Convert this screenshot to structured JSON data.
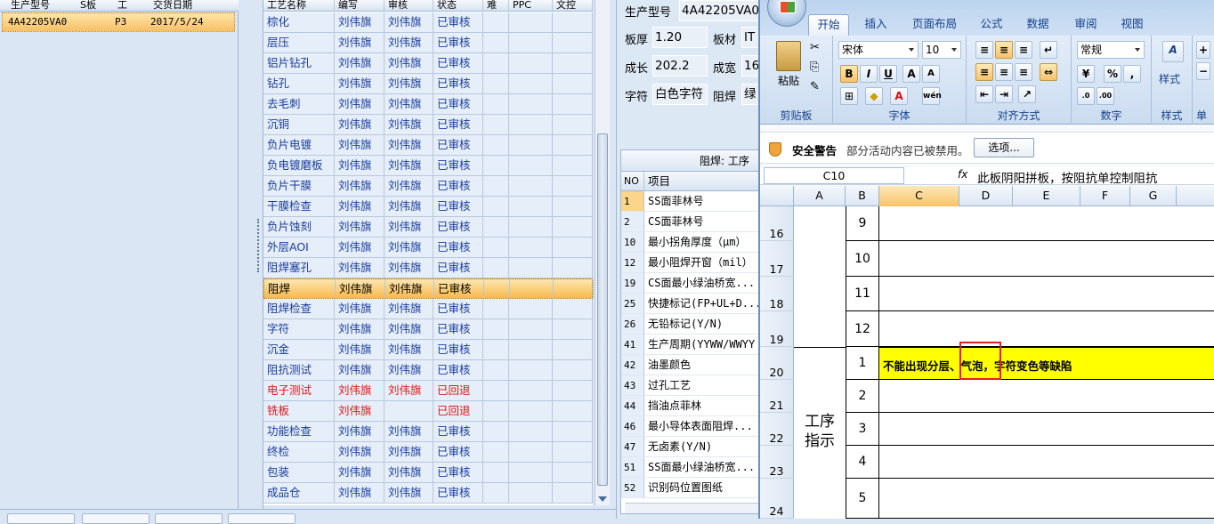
{
  "left_panel": {
    "headers": [
      "生产型号",
      "S板",
      "工",
      "交货日期"
    ],
    "row": {
      "model": "4A42205VA0",
      "grade": "P3",
      "date": "2017/5/24"
    }
  },
  "process_grid": {
    "headers": [
      "工艺名称",
      "编写",
      "审核",
      "状态",
      "难",
      "PPC",
      "文控"
    ],
    "rows": [
      {
        "name": "棕化",
        "writer": "刘伟旗",
        "reviewer": "刘伟旗",
        "status": "已审核"
      },
      {
        "name": "层压",
        "writer": "刘伟旗",
        "reviewer": "刘伟旗",
        "status": "已审核"
      },
      {
        "name": "铝片钻孔",
        "writer": "刘伟旗",
        "reviewer": "刘伟旗",
        "status": "已审核"
      },
      {
        "name": "钻孔",
        "writer": "刘伟旗",
        "reviewer": "刘伟旗",
        "status": "已审核"
      },
      {
        "name": "去毛刺",
        "writer": "刘伟旗",
        "reviewer": "刘伟旗",
        "status": "已审核"
      },
      {
        "name": "沉铜",
        "writer": "刘伟旗",
        "reviewer": "刘伟旗",
        "status": "已审核"
      },
      {
        "name": "负片电镀",
        "writer": "刘伟旗",
        "reviewer": "刘伟旗",
        "status": "已审核"
      },
      {
        "name": "负电镀磨板",
        "writer": "刘伟旗",
        "reviewer": "刘伟旗",
        "status": "已审核"
      },
      {
        "name": "负片干膜",
        "writer": "刘伟旗",
        "reviewer": "刘伟旗",
        "status": "已审核"
      },
      {
        "name": "干膜检查",
        "writer": "刘伟旗",
        "reviewer": "刘伟旗",
        "status": "已审核"
      },
      {
        "name": "负片蚀刻",
        "writer": "刘伟旗",
        "reviewer": "刘伟旗",
        "status": "已审核"
      },
      {
        "name": "外层AOI",
        "writer": "刘伟旗",
        "reviewer": "刘伟旗",
        "status": "已审核"
      },
      {
        "name": "阻焊塞孔",
        "writer": "刘伟旗",
        "reviewer": "刘伟旗",
        "status": "已审核"
      },
      {
        "name": "阻焊",
        "writer": "刘伟旗",
        "reviewer": "刘伟旗",
        "status": "已审核"
      },
      {
        "name": "阻焊检查",
        "writer": "刘伟旗",
        "reviewer": "刘伟旗",
        "status": "已审核"
      },
      {
        "name": "字符",
        "writer": "刘伟旗",
        "reviewer": "刘伟旗",
        "status": "已审核"
      },
      {
        "name": "沉金",
        "writer": "刘伟旗",
        "reviewer": "刘伟旗",
        "status": "已审核"
      },
      {
        "name": "阻抗测试",
        "writer": "刘伟旗",
        "reviewer": "刘伟旗",
        "status": "已审核"
      },
      {
        "name": "电子测试",
        "writer": "刘伟旗",
        "reviewer": "刘伟旗",
        "status": "已回退"
      },
      {
        "name": "铣板",
        "writer": "刘伟旗",
        "reviewer": "",
        "status": "已回退"
      },
      {
        "name": "功能检查",
        "writer": "刘伟旗",
        "reviewer": "刘伟旗",
        "status": "已审核"
      },
      {
        "name": "终检",
        "writer": "刘伟旗",
        "reviewer": "刘伟旗",
        "status": "已审核"
      },
      {
        "name": "包装",
        "writer": "刘伟旗",
        "reviewer": "刘伟旗",
        "status": "已审核"
      },
      {
        "name": "成品仓",
        "writer": "刘伟旗",
        "reviewer": "刘伟旗",
        "status": "已审核"
      }
    ]
  },
  "detail_panel": {
    "model_label": "生产型号",
    "model_value": "4A42205VA0",
    "thickness_label": "板厚",
    "thickness_value": "1.20",
    "material_label": "板材",
    "material_value": "IT",
    "length_label": "成长",
    "length_value": "202.2",
    "width_label": "成宽",
    "width_value": "16",
    "char_label": "字符",
    "char_value": "白色字符",
    "solder_label": "阻焊",
    "solder_value": "绿",
    "grid_caption": "阻焊: 工序",
    "grid_headers": [
      "NO",
      "项目"
    ],
    "items": [
      {
        "no": "1",
        "item": "SS面菲林号"
      },
      {
        "no": "2",
        "item": "CS面菲林号"
      },
      {
        "no": "10",
        "item": "最小拐角厚度（μm）"
      },
      {
        "no": "12",
        "item": "最小阻焊开窗（mil）"
      },
      {
        "no": "19",
        "item": "CS面最小绿油桥宽..."
      },
      {
        "no": "25",
        "item": "快捷标记(FP+UL+D..."
      },
      {
        "no": "26",
        "item": "无铅标记(Y/N)"
      },
      {
        "no": "41",
        "item": "生产周期(YYWW/WWYY"
      },
      {
        "no": "42",
        "item": "油墨颜色"
      },
      {
        "no": "43",
        "item": "过孔工艺"
      },
      {
        "no": "44",
        "item": "挡油点菲林"
      },
      {
        "no": "46",
        "item": "最小导体表面阻焊..."
      },
      {
        "no": "47",
        "item": "无卤素(Y/N)"
      },
      {
        "no": "51",
        "item": "SS面最小绿油桥宽..."
      },
      {
        "no": "52",
        "item": "识别码位置图纸"
      }
    ]
  },
  "excel": {
    "tabs": [
      "开始",
      "插入",
      "页面布局",
      "公式",
      "数据",
      "审阅",
      "视图"
    ],
    "font_name": "宋体",
    "font_size": "10",
    "number_format": "常规",
    "groups": [
      "剪贴板",
      "字体",
      "对齐方式",
      "数字",
      "样式",
      "单"
    ],
    "paste_label": "粘贴",
    "style_label": "样式",
    "security_title": "安全警告",
    "security_msg": "部分活动内容已被禁用。",
    "options_btn": "选项...",
    "name_box": "C10",
    "fx": "fx",
    "formula": "此板阴阳拼板，按阻抗单控制阻抗",
    "columns": [
      "A",
      "B",
      "C",
      "D",
      "E",
      "F",
      "G"
    ],
    "row_numbers": [
      "16",
      "17",
      "18",
      "19",
      "20",
      "21",
      "22",
      "23",
      "24"
    ],
    "b_values": [
      "9",
      "10",
      "11",
      "12",
      "1",
      "2",
      "3",
      "4",
      "5"
    ],
    "merged_label_1": "工序",
    "merged_label_2": "指示",
    "highlight_text": "不能出现分层、气泡，字符变色等缺陷",
    "highlight_color": "#ffff00"
  }
}
